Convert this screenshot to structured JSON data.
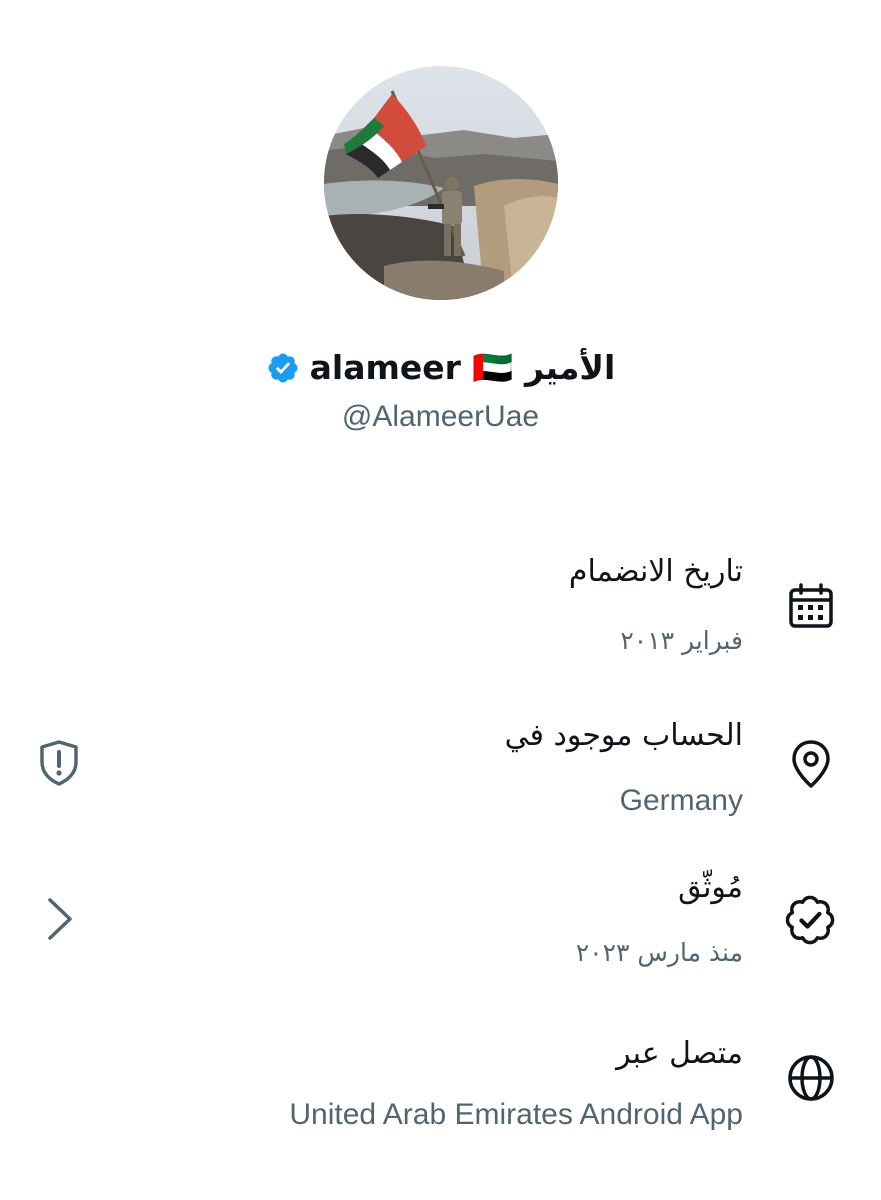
{
  "profile": {
    "display_name": "alameer 🇦🇪 الأمير",
    "handle": "@AlameerUae",
    "avatar_icon": "profile-photo-soldier-with-uae-flag",
    "verified_icon": "verified-badge-icon",
    "verified_color": "#1d9bf0"
  },
  "info": {
    "joined": {
      "label": "تاريخ الانضمام",
      "value": "فبراير ٢٠١٣",
      "icon": "calendar-icon"
    },
    "location": {
      "label": "الحساب موجود في",
      "value": "Germany",
      "icon": "location-pin-icon",
      "side_icon": "shield-alert-icon"
    },
    "verified": {
      "label": "مُوثّق",
      "value": "منذ مارس ٢٠٢٣",
      "icon": "verified-check-icon",
      "side_icon": "chevron-right-icon"
    },
    "connected": {
      "label": "متصل عبر",
      "value": "United Arab Emirates Android App",
      "icon": "globe-icon"
    }
  },
  "colors": {
    "text_primary": "#0f1419",
    "text_secondary": "#536471",
    "background": "#ffffff"
  }
}
